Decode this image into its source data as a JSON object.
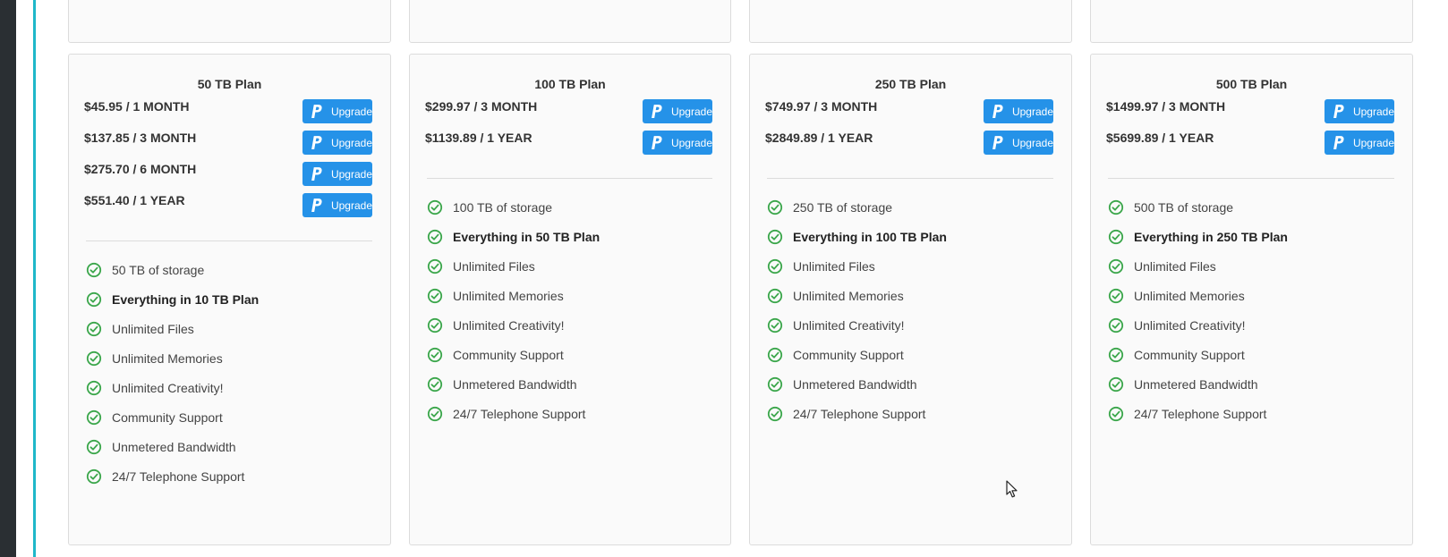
{
  "colors": {
    "accent": "#1fb7c9",
    "button": "#2592e8",
    "check": "#3aa64a",
    "sidebar": "#2a2f33"
  },
  "icons": {
    "button_icon": "paypal-icon",
    "feature_icon": "check-circle-icon"
  },
  "upgrade_label": "Upgrade",
  "plans": [
    {
      "title": "50 TB Plan",
      "prices": [
        "$45.95 / 1 MONTH",
        "$137.85 / 3 MONTH",
        "$275.70 / 6 MONTH",
        "$551.40 / 1 YEAR"
      ],
      "features": [
        {
          "text": "50 TB of storage",
          "bold": false
        },
        {
          "text": "Everything in 10 TB Plan",
          "bold": true
        },
        {
          "text": "Unlimited Files",
          "bold": false
        },
        {
          "text": "Unlimited Memories",
          "bold": false
        },
        {
          "text": "Unlimited Creativity!",
          "bold": false
        },
        {
          "text": "Community Support",
          "bold": false
        },
        {
          "text": "Unmetered Bandwidth",
          "bold": false
        },
        {
          "text": "24/7 Telephone Support",
          "bold": false
        }
      ]
    },
    {
      "title": "100 TB Plan",
      "prices": [
        "$299.97 / 3 MONTH",
        "$1139.89 / 1 YEAR"
      ],
      "features": [
        {
          "text": "100 TB of storage",
          "bold": false
        },
        {
          "text": "Everything in 50 TB Plan",
          "bold": true
        },
        {
          "text": "Unlimited Files",
          "bold": false
        },
        {
          "text": "Unlimited Memories",
          "bold": false
        },
        {
          "text": "Unlimited Creativity!",
          "bold": false
        },
        {
          "text": "Community Support",
          "bold": false
        },
        {
          "text": "Unmetered Bandwidth",
          "bold": false
        },
        {
          "text": "24/7 Telephone Support",
          "bold": false
        }
      ]
    },
    {
      "title": "250 TB Plan",
      "prices": [
        "$749.97 / 3 MONTH",
        "$2849.89 / 1 YEAR"
      ],
      "features": [
        {
          "text": "250 TB of storage",
          "bold": false
        },
        {
          "text": "Everything in 100 TB Plan",
          "bold": true
        },
        {
          "text": "Unlimited Files",
          "bold": false
        },
        {
          "text": "Unlimited Memories",
          "bold": false
        },
        {
          "text": "Unlimited Creativity!",
          "bold": false
        },
        {
          "text": "Community Support",
          "bold": false
        },
        {
          "text": "Unmetered Bandwidth",
          "bold": false
        },
        {
          "text": "24/7 Telephone Support",
          "bold": false
        }
      ]
    },
    {
      "title": "500 TB Plan",
      "prices": [
        "$1499.97 / 3 MONTH",
        "$5699.89 / 1 YEAR"
      ],
      "features": [
        {
          "text": "500 TB of storage",
          "bold": false
        },
        {
          "text": "Everything in 250 TB Plan",
          "bold": true
        },
        {
          "text": "Unlimited Files",
          "bold": false
        },
        {
          "text": "Unlimited Memories",
          "bold": false
        },
        {
          "text": "Unlimited Creativity!",
          "bold": false
        },
        {
          "text": "Community Support",
          "bold": false
        },
        {
          "text": "Unmetered Bandwidth",
          "bold": false
        },
        {
          "text": "24/7 Telephone Support",
          "bold": false
        }
      ]
    }
  ]
}
